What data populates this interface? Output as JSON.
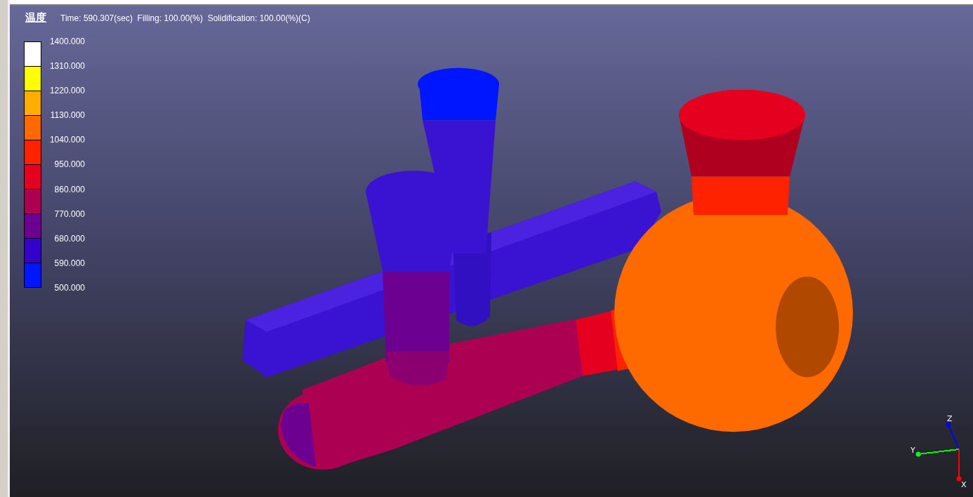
{
  "header": {
    "title": "温度",
    "info": "Time: 590.307(sec)  Filling: 100.00(%)  Solidification: 100.00(%)(C)"
  },
  "legend": {
    "bands": [
      {
        "color": "#ffffff"
      },
      {
        "color": "#ffff00"
      },
      {
        "color": "#ffae00"
      },
      {
        "color": "#ff6a00"
      },
      {
        "color": "#ff2200"
      },
      {
        "color": "#e4001e"
      },
      {
        "color": "#ac0052"
      },
      {
        "color": "#6c0090"
      },
      {
        "color": "#3300cc"
      },
      {
        "color": "#0016ff"
      }
    ],
    "labels": [
      "1400.000",
      "1310.000",
      "1220.000",
      "1130.000",
      "1040.000",
      "950.000",
      "860.000",
      "770.000",
      "680.000",
      "590.000",
      "500.000"
    ]
  },
  "axes": [
    {
      "label": "Z",
      "color": "#0000ff"
    },
    {
      "label": "Y",
      "color": "#00ff00"
    },
    {
      "label": "X",
      "color": "#ff0000"
    }
  ]
}
